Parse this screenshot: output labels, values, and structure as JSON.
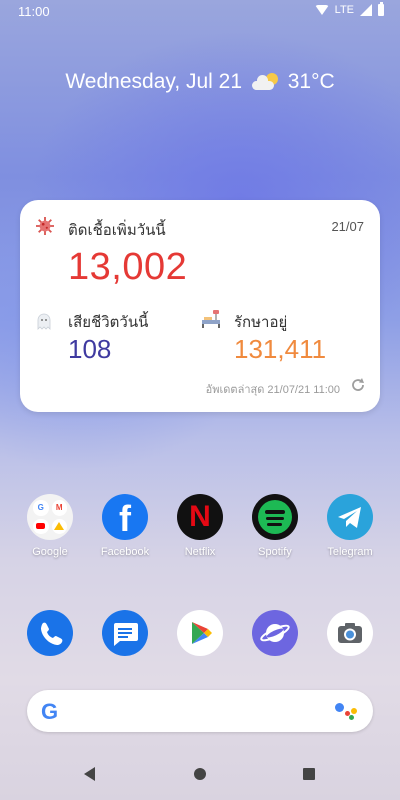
{
  "statusbar": {
    "time": "11:00",
    "network": "LTE"
  },
  "datetime": {
    "date": "Wednesday, Jul 21",
    "temperature": "31°C"
  },
  "widget": {
    "title": "ติดเชื้อเพิ่มวันนี้",
    "date": "21/07",
    "new_cases": "13,002",
    "deaths_label": "เสียชีวิตวันนี้",
    "deaths": "108",
    "treating_label": "รักษาอยู่",
    "treating": "131,411",
    "updated": "อัพเดตล่าสุด  21/07/21 11:00"
  },
  "apps_row1": [
    {
      "label": "Google",
      "icon": "google-folder"
    },
    {
      "label": "Facebook",
      "icon": "facebook-icon"
    },
    {
      "label": "Netflix",
      "icon": "netflix-icon"
    },
    {
      "label": "Spotify",
      "icon": "spotify-icon"
    },
    {
      "label": "Telegram",
      "icon": "telegram-icon"
    }
  ],
  "apps_row2": [
    {
      "icon": "phone-icon"
    },
    {
      "icon": "messages-icon"
    },
    {
      "icon": "play-store-icon"
    },
    {
      "icon": "internet-icon"
    },
    {
      "icon": "camera-icon"
    }
  ],
  "search": {
    "logo": "G"
  },
  "colors": {
    "cases": "#e53935",
    "deaths": "#3f3aa0",
    "treating": "#f08a3e"
  }
}
